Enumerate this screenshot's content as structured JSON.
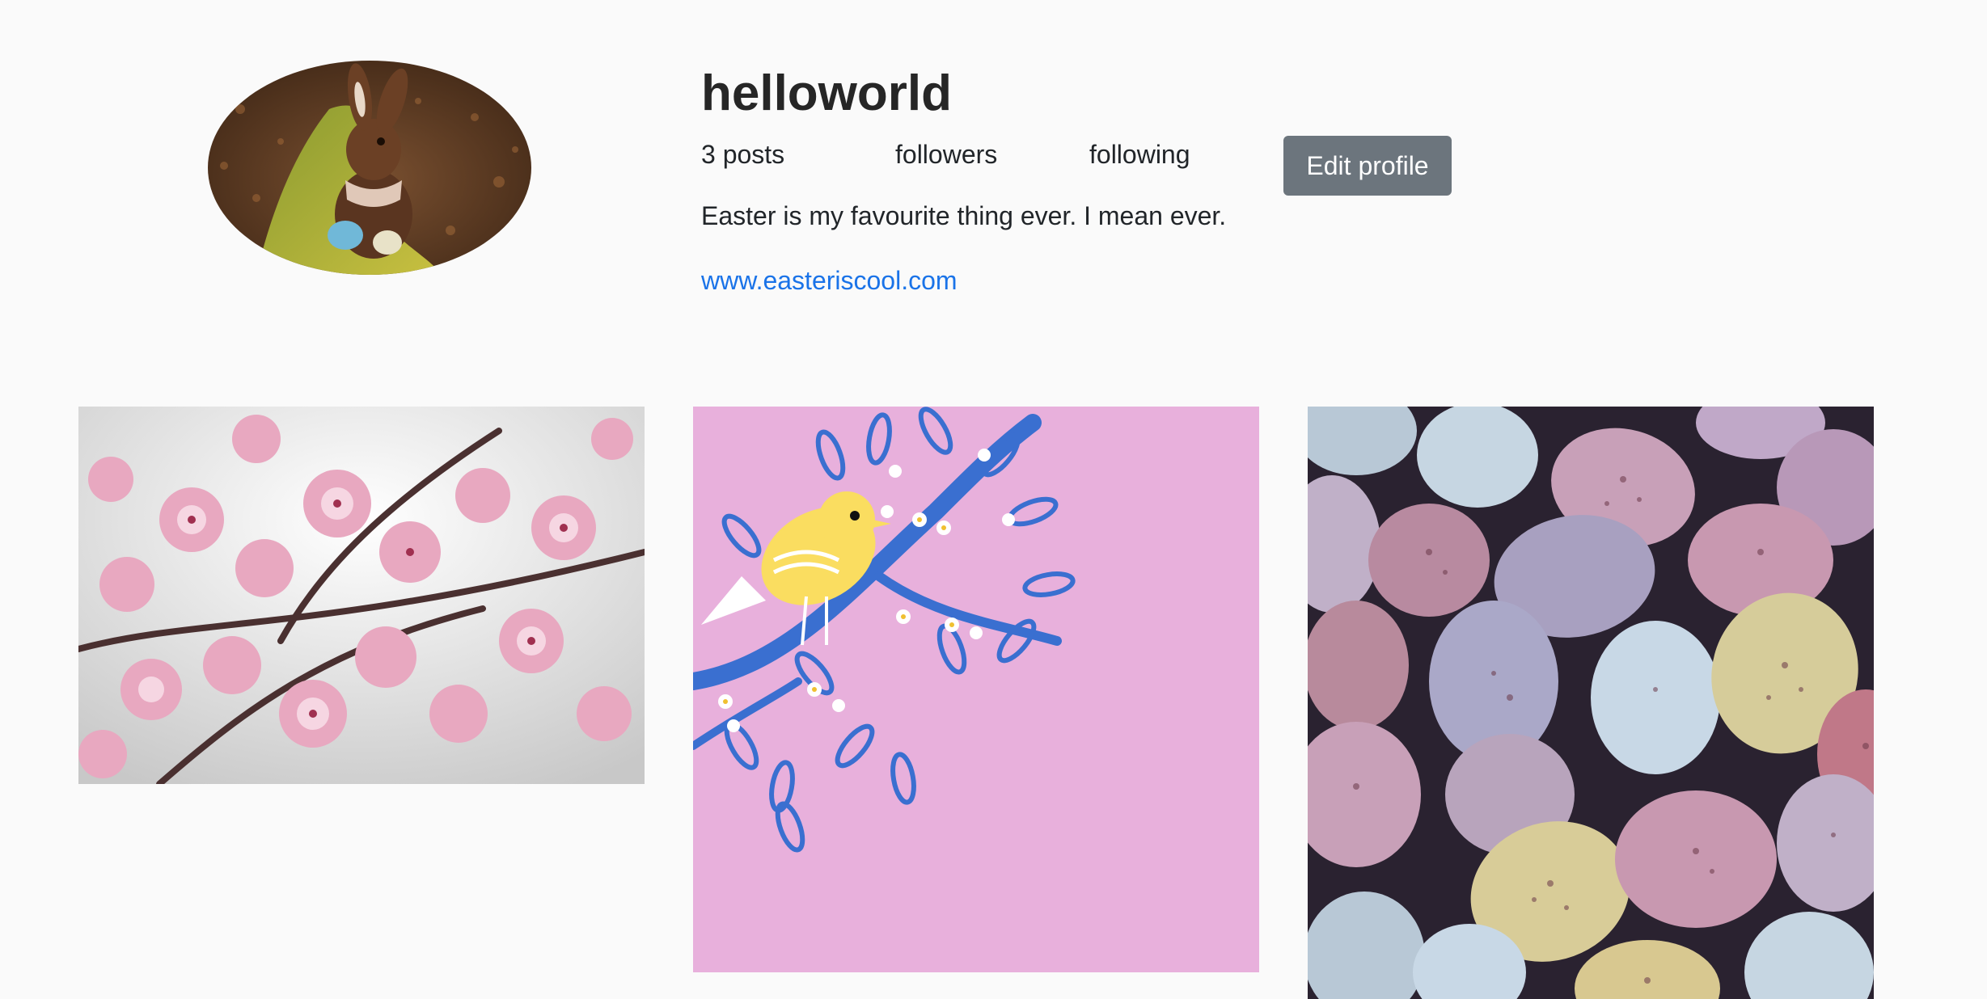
{
  "profile": {
    "username": "helloworld",
    "avatar_icon": "chocolate-bunny-photo",
    "stats": {
      "posts": "3 posts",
      "followers": "followers",
      "following": "following"
    },
    "edit_button_label": "Edit profile",
    "bio": "Easter is my favourite thing ever. I mean ever.",
    "website": "www.easteriscool.com"
  },
  "posts": [
    {
      "icon": "cherry-blossom-photo"
    },
    {
      "icon": "yellow-bird-on-branch-illustration"
    },
    {
      "icon": "speckled-easter-eggs-photo"
    }
  ],
  "colors": {
    "background": "#fafafa",
    "button": "#6c757d",
    "link": "#1a73e8",
    "post2_background": "#e8b0dc"
  }
}
